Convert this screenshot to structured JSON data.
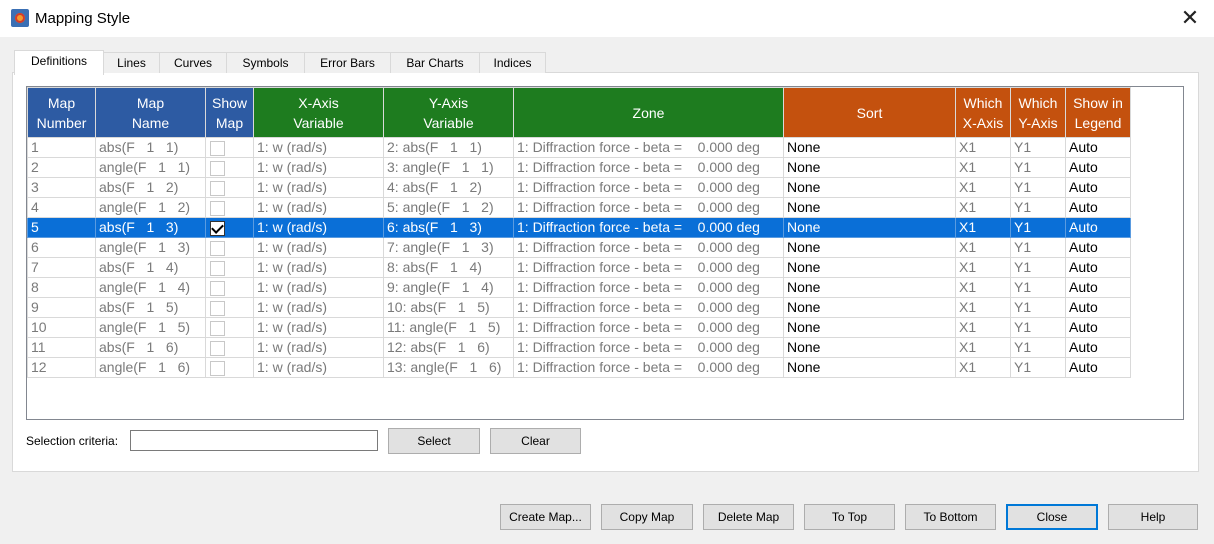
{
  "window": {
    "title": "Mapping Style",
    "close_glyph": "✕"
  },
  "tabs": [
    {
      "label": "Definitions"
    },
    {
      "label": "Lines"
    },
    {
      "label": "Curves"
    },
    {
      "label": "Symbols"
    },
    {
      "label": "Error Bars"
    },
    {
      "label": "Bar Charts"
    },
    {
      "label": "Indices"
    }
  ],
  "table": {
    "headers": {
      "map_number": [
        "Map",
        "Number"
      ],
      "map_name": [
        "Map",
        "Name"
      ],
      "show_map": [
        "Show",
        "Map"
      ],
      "x_axis_variable": [
        "X-Axis",
        "Variable"
      ],
      "y_axis_variable": [
        "Y-Axis",
        "Variable"
      ],
      "zone": [
        "Zone"
      ],
      "sort": [
        "Sort"
      ],
      "which_x_axis": [
        "Which",
        "X-Axis"
      ],
      "which_y_axis": [
        "Which",
        "Y-Axis"
      ],
      "show_in_legend": [
        "Show in",
        "Legend"
      ]
    },
    "header_colors": {
      "blue": "#2d5ba3",
      "green": "#1e7c1f",
      "orange": "#c4510e"
    },
    "selected_color": "#0a6fd7",
    "rows": [
      {
        "num": "1",
        "name": "abs(F   1   1)",
        "show": false,
        "x": "1: w (rad/s)",
        "y": "2: abs(F   1   1)",
        "zone": "1: Diffraction force - beta =    0.000 deg",
        "sort": "None",
        "wx": "X1",
        "wy": "Y1",
        "legend": "Auto",
        "selected": false
      },
      {
        "num": "2",
        "name": "angle(F   1   1)",
        "show": false,
        "x": "1: w (rad/s)",
        "y": "3: angle(F   1   1)",
        "zone": "1: Diffraction force - beta =    0.000 deg",
        "sort": "None",
        "wx": "X1",
        "wy": "Y1",
        "legend": "Auto",
        "selected": false
      },
      {
        "num": "3",
        "name": "abs(F   1   2)",
        "show": false,
        "x": "1: w (rad/s)",
        "y": "4: abs(F   1   2)",
        "zone": "1: Diffraction force - beta =    0.000 deg",
        "sort": "None",
        "wx": "X1",
        "wy": "Y1",
        "legend": "Auto",
        "selected": false
      },
      {
        "num": "4",
        "name": "angle(F   1   2)",
        "show": false,
        "x": "1: w (rad/s)",
        "y": "5: angle(F   1   2)",
        "zone": "1: Diffraction force - beta =    0.000 deg",
        "sort": "None",
        "wx": "X1",
        "wy": "Y1",
        "legend": "Auto",
        "selected": false
      },
      {
        "num": "5",
        "name": "abs(F   1   3)",
        "show": true,
        "x": "1: w (rad/s)",
        "y": "6: abs(F   1   3)",
        "zone": "1: Diffraction force - beta =    0.000 deg",
        "sort": "None",
        "wx": "X1",
        "wy": "Y1",
        "legend": "Auto",
        "selected": true
      },
      {
        "num": "6",
        "name": "angle(F   1   3)",
        "show": false,
        "x": "1: w (rad/s)",
        "y": "7: angle(F   1   3)",
        "zone": "1: Diffraction force - beta =    0.000 deg",
        "sort": "None",
        "wx": "X1",
        "wy": "Y1",
        "legend": "Auto",
        "selected": false
      },
      {
        "num": "7",
        "name": "abs(F   1   4)",
        "show": false,
        "x": "1: w (rad/s)",
        "y": "8: abs(F   1   4)",
        "zone": "1: Diffraction force - beta =    0.000 deg",
        "sort": "None",
        "wx": "X1",
        "wy": "Y1",
        "legend": "Auto",
        "selected": false
      },
      {
        "num": "8",
        "name": "angle(F   1   4)",
        "show": false,
        "x": "1: w (rad/s)",
        "y": "9: angle(F   1   4)",
        "zone": "1: Diffraction force - beta =    0.000 deg",
        "sort": "None",
        "wx": "X1",
        "wy": "Y1",
        "legend": "Auto",
        "selected": false
      },
      {
        "num": "9",
        "name": "abs(F   1   5)",
        "show": false,
        "x": "1: w (rad/s)",
        "y": "10: abs(F   1   5)",
        "zone": "1: Diffraction force - beta =    0.000 deg",
        "sort": "None",
        "wx": "X1",
        "wy": "Y1",
        "legend": "Auto",
        "selected": false
      },
      {
        "num": "10",
        "name": "angle(F   1   5)",
        "show": false,
        "x": "1: w (rad/s)",
        "y": "11: angle(F   1   5)",
        "zone": "1: Diffraction force - beta =    0.000 deg",
        "sort": "None",
        "wx": "X1",
        "wy": "Y1",
        "legend": "Auto",
        "selected": false
      },
      {
        "num": "11",
        "name": "abs(F   1   6)",
        "show": false,
        "x": "1: w (rad/s)",
        "y": "12: abs(F   1   6)",
        "zone": "1: Diffraction force - beta =    0.000 deg",
        "sort": "None",
        "wx": "X1",
        "wy": "Y1",
        "legend": "Auto",
        "selected": false
      },
      {
        "num": "12",
        "name": "angle(F   1   6)",
        "show": false,
        "x": "1: w (rad/s)",
        "y": "13: angle(F   1   6)",
        "zone": "1: Diffraction force - beta =    0.000 deg",
        "sort": "None",
        "wx": "X1",
        "wy": "Y1",
        "legend": "Auto",
        "selected": false
      }
    ]
  },
  "selection": {
    "label": "Selection criteria:",
    "value": "",
    "select_label": "Select",
    "clear_label": "Clear"
  },
  "footer": {
    "create_map": "Create Map...",
    "copy_map": "Copy Map",
    "delete_map": "Delete Map",
    "to_top": "To Top",
    "to_bottom": "To Bottom",
    "close": "Close",
    "help": "Help"
  }
}
